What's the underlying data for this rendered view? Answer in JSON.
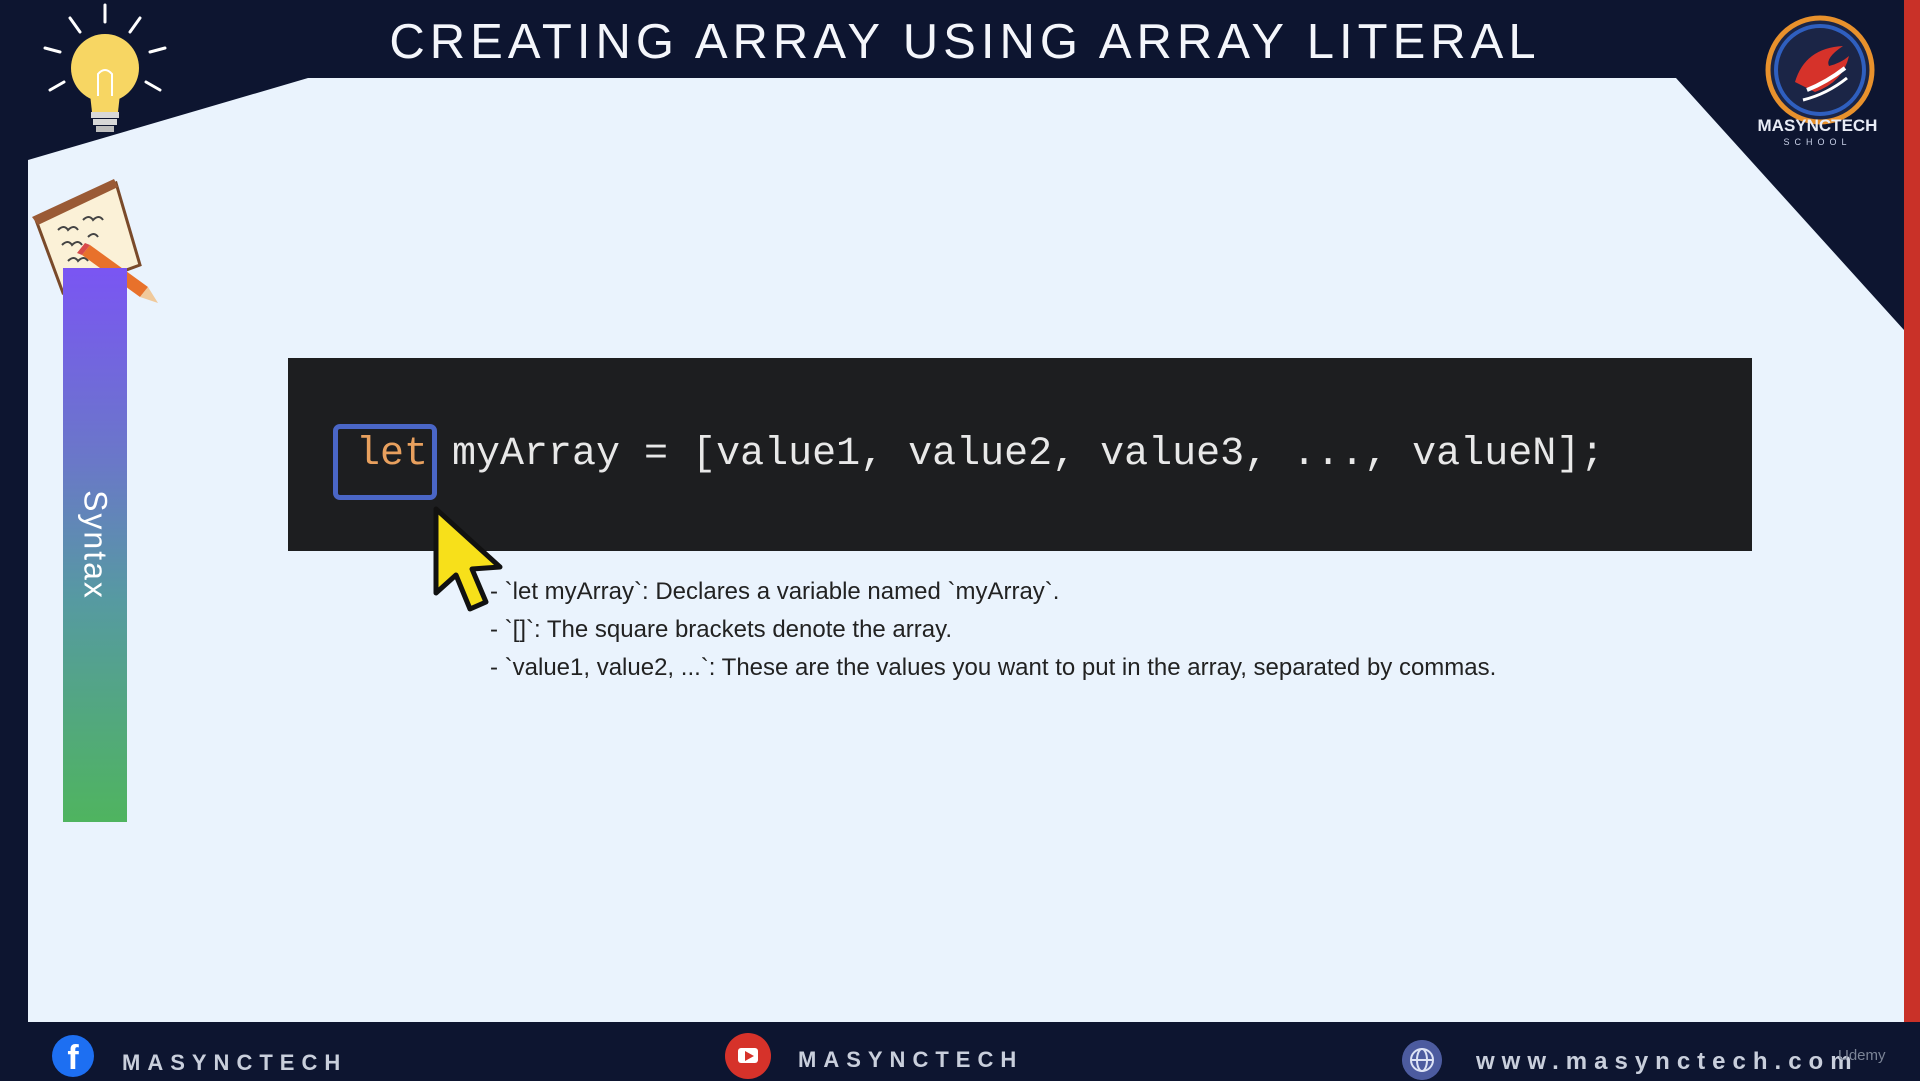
{
  "slide": {
    "title": "CREATING ARRAY USING ARRAY LITERAL",
    "side_label": "Syntax"
  },
  "brand": {
    "name": "MASYNCTECH",
    "sub": "SCHOOL"
  },
  "code": {
    "keyword": "let",
    "rest": " myArray = [value1, value2, value3, ..., valueN];"
  },
  "notes": [
    "- `let myArray`: Declares a variable named `myArray`.",
    "- `[]`: The square brackets denote the array.",
    "- `value1, value2, ...`: These are the values you want to put in the array, separated by commas."
  ],
  "footer": {
    "facebook_label": "MASYNCTECH",
    "youtube_label": "MASYNCTECH",
    "website": "www.masynctech.com",
    "watermark": "Udemy"
  },
  "colors": {
    "background": "#0d1530",
    "panel": "#eaf3fd",
    "code_bg": "#1d1e20",
    "keyword": "#e8a05e",
    "highlight": "#4a66c6",
    "accent_red": "#c93128"
  },
  "icons": [
    "lightbulb-icon",
    "notebook-icon",
    "cursor-icon",
    "facebook-icon",
    "youtube-icon",
    "globe-icon",
    "masynctech-logo"
  ]
}
